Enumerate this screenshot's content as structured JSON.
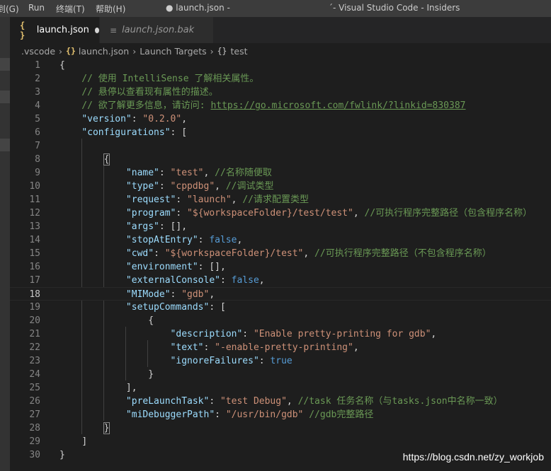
{
  "titlebar": {
    "menu": [
      "到(G)",
      "Run",
      "终端(T)",
      "帮助(H)"
    ],
    "file_title": "● launch.json -",
    "app_title": "´- Visual Studio Code - Insiders"
  },
  "tabs": [
    {
      "icon": "{ }",
      "label": "launch.json",
      "dirty": true,
      "active": true
    },
    {
      "icon": "≡",
      "label": "launch.json.bak",
      "active": false
    }
  ],
  "breadcrumb": [
    ".vscode",
    "launch.json",
    "Launch Targets",
    "test"
  ],
  "code_lines": [
    [
      [
        "brace",
        "{"
      ]
    ],
    [
      [
        "cmt",
        "    // 使用 IntelliSense 了解相关属性。"
      ]
    ],
    [
      [
        "cmt",
        "    // 悬停以查看现有属性的描述。"
      ]
    ],
    [
      [
        "cmt",
        "    // 欲了解更多信息，请访问: "
      ],
      [
        "link",
        "https://go.microsoft.com/fwlink/?linkid=830387"
      ]
    ],
    [
      [
        "punct",
        "    "
      ],
      [
        "key",
        "\"version\""
      ],
      [
        "punct",
        ": "
      ],
      [
        "str",
        "\"0.2.0\""
      ],
      [
        "punct",
        ","
      ]
    ],
    [
      [
        "punct",
        "    "
      ],
      [
        "key",
        "\"configurations\""
      ],
      [
        "punct",
        ": "
      ],
      [
        "bracket",
        "["
      ]
    ],
    [],
    [
      [
        "punct",
        "        "
      ],
      [
        "match",
        "{"
      ]
    ],
    [
      [
        "punct",
        "            "
      ],
      [
        "key",
        "\"name\""
      ],
      [
        "punct",
        ": "
      ],
      [
        "str",
        "\"test\""
      ],
      [
        "punct",
        ", "
      ],
      [
        "cmt",
        "//名称随便取"
      ]
    ],
    [
      [
        "punct",
        "            "
      ],
      [
        "key",
        "\"type\""
      ],
      [
        "punct",
        ": "
      ],
      [
        "str",
        "\"cppdbg\""
      ],
      [
        "punct",
        ", "
      ],
      [
        "cmt",
        "//调试类型"
      ]
    ],
    [
      [
        "punct",
        "            "
      ],
      [
        "key",
        "\"request\""
      ],
      [
        "punct",
        ": "
      ],
      [
        "str",
        "\"launch\""
      ],
      [
        "punct",
        ", "
      ],
      [
        "cmt",
        "//请求配置类型"
      ]
    ],
    [
      [
        "punct",
        "            "
      ],
      [
        "key",
        "\"program\""
      ],
      [
        "punct",
        ": "
      ],
      [
        "str",
        "\"${workspaceFolder}/test/test\""
      ],
      [
        "punct",
        ", "
      ],
      [
        "cmt",
        "//可执行程序完整路径（包含程序名称）"
      ]
    ],
    [
      [
        "punct",
        "            "
      ],
      [
        "key",
        "\"args\""
      ],
      [
        "punct",
        ": [],"
      ]
    ],
    [
      [
        "punct",
        "            "
      ],
      [
        "key",
        "\"stopAtEntry\""
      ],
      [
        "punct",
        ": "
      ],
      [
        "bool",
        "false"
      ],
      [
        "punct",
        ","
      ]
    ],
    [
      [
        "punct",
        "            "
      ],
      [
        "key",
        "\"cwd\""
      ],
      [
        "punct",
        ": "
      ],
      [
        "str",
        "\"${workspaceFolder}/test\""
      ],
      [
        "punct",
        ", "
      ],
      [
        "cmt",
        "//可执行程序完整路径（不包含程序名称）"
      ]
    ],
    [
      [
        "punct",
        "            "
      ],
      [
        "key",
        "\"environment\""
      ],
      [
        "punct",
        ": [],"
      ]
    ],
    [
      [
        "punct",
        "            "
      ],
      [
        "key",
        "\"externalConsole\""
      ],
      [
        "punct",
        ": "
      ],
      [
        "bool",
        "false"
      ],
      [
        "punct",
        ","
      ]
    ],
    [
      [
        "punct",
        "            "
      ],
      [
        "key",
        "\"MIMode\""
      ],
      [
        "punct",
        ": "
      ],
      [
        "str",
        "\"gdb\""
      ],
      [
        "punct",
        ","
      ]
    ],
    [
      [
        "punct",
        "            "
      ],
      [
        "key",
        "\"setupCommands\""
      ],
      [
        "punct",
        ": "
      ],
      [
        "bracket",
        "["
      ]
    ],
    [
      [
        "punct",
        "                "
      ],
      [
        "brace",
        "{"
      ]
    ],
    [
      [
        "punct",
        "                    "
      ],
      [
        "key",
        "\"description\""
      ],
      [
        "punct",
        ": "
      ],
      [
        "str",
        "\"Enable pretty-printing for gdb\""
      ],
      [
        "punct",
        ","
      ]
    ],
    [
      [
        "punct",
        "                    "
      ],
      [
        "key",
        "\"text\""
      ],
      [
        "punct",
        ": "
      ],
      [
        "str",
        "\"-enable-pretty-printing\""
      ],
      [
        "punct",
        ","
      ]
    ],
    [
      [
        "punct",
        "                    "
      ],
      [
        "key",
        "\"ignoreFailures\""
      ],
      [
        "punct",
        ": "
      ],
      [
        "bool",
        "true"
      ]
    ],
    [
      [
        "punct",
        "                "
      ],
      [
        "brace",
        "}"
      ]
    ],
    [
      [
        "punct",
        "            "
      ],
      [
        "bracket",
        "],"
      ]
    ],
    [
      [
        "punct",
        "            "
      ],
      [
        "key",
        "\"preLaunchTask\""
      ],
      [
        "punct",
        ": "
      ],
      [
        "str",
        "\"test Debug\""
      ],
      [
        "punct",
        ", "
      ],
      [
        "cmt",
        "//task 任务名称（与tasks.json中名称一致）"
      ]
    ],
    [
      [
        "punct",
        "            "
      ],
      [
        "key",
        "\"miDebuggerPath\""
      ],
      [
        "punct",
        ": "
      ],
      [
        "str",
        "\"/usr/bin/gdb\""
      ],
      [
        "punct",
        " "
      ],
      [
        "cmt",
        "//gdb完整路径"
      ]
    ],
    [
      [
        "punct",
        "        "
      ],
      [
        "match",
        "}"
      ]
    ],
    [
      [
        "punct",
        "    "
      ],
      [
        "bracket",
        "]"
      ]
    ],
    [
      [
        "brace",
        "}"
      ]
    ]
  ],
  "current_line": 18,
  "watermark": "https://blog.csdn.net/zy_workjob"
}
